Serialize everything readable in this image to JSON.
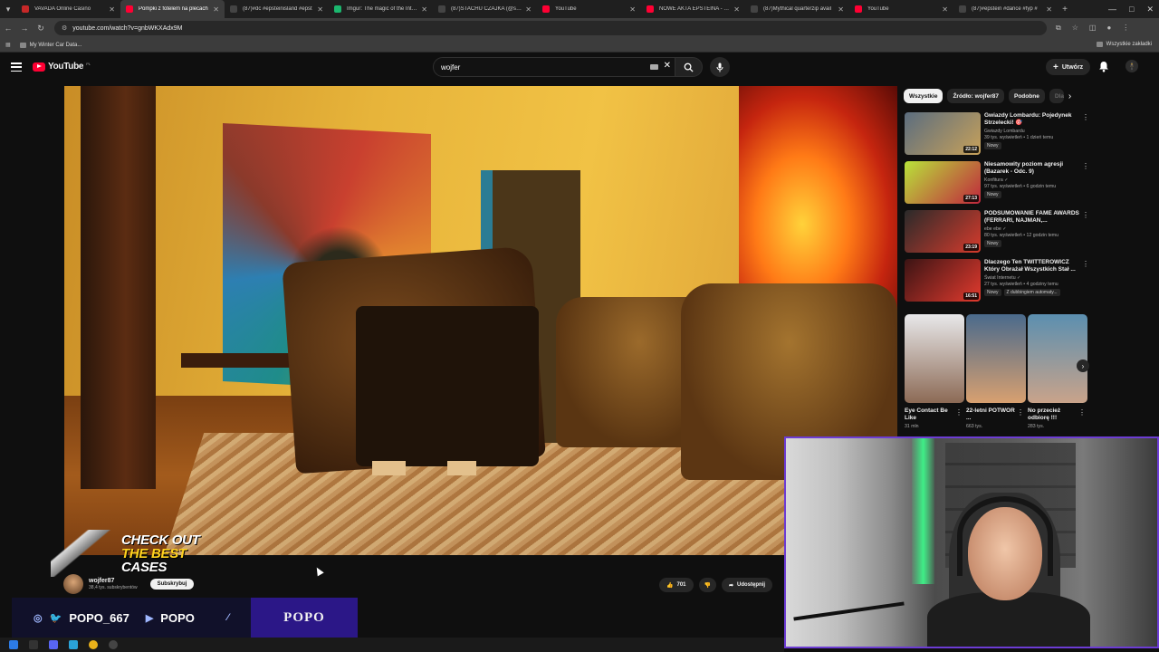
{
  "browser": {
    "tabs": [
      {
        "label": "VAVADA Online Casino",
        "color": "#c62828",
        "active": false
      },
      {
        "label": "Pompki z fotelem na plecach",
        "color": "#ff0033",
        "active": true
      },
      {
        "label": "(87)#dc #epsteinisland #epst",
        "color": "#444",
        "active": false
      },
      {
        "label": "Imgur: The magic of the Intern",
        "color": "#1bb76e",
        "active": false
      },
      {
        "label": "(87)STACHU CZAJKA (@stach",
        "color": "#444",
        "active": false
      },
      {
        "label": "YouTube",
        "color": "#ff0033",
        "active": false
      },
      {
        "label": "NOWE AKTA EPSTEINA - TRU",
        "color": "#ff0033",
        "active": false
      },
      {
        "label": "(87)Mythical quarterzip avail",
        "color": "#444",
        "active": false
      },
      {
        "label": "YouTube",
        "color": "#ff0033",
        "active": false
      },
      {
        "label": "(87)#epstein #dance #fyp #",
        "color": "#444",
        "active": false
      }
    ],
    "url": "youtube.com/watch?v=gnbWKXAdx9M",
    "bookmark": "My Winter Car Data...",
    "bookmarks_all": "Wszystkie zakładki"
  },
  "youtube": {
    "logo": "YouTube",
    "logo_country": "PL",
    "search_value": "wojfer",
    "create_label": "Utwórz"
  },
  "video": {
    "channel_name": "wojfer87",
    "subscribers": "38,4 tys. subskrybentów",
    "subscribe_label": "Subskrybuj",
    "likes": "701",
    "share_label": "Udostępnij"
  },
  "sidebar": {
    "chips": [
      "Wszystkie",
      "Źródło: wojfer87",
      "Podobne",
      "Dla"
    ],
    "recommendations": [
      {
        "title": "Gwiazdy Lombardu: Pojedynek Strzelecki! 🎯",
        "channel": "Gwiazdy Lombardu",
        "views": "39 tys. wyświetleń • 1 dzień temu",
        "duration": "22:12",
        "badges": [
          "Nowy"
        ],
        "thumb_colors": [
          "#5b6d7f",
          "#c7a15a"
        ]
      },
      {
        "title": "Niesamowity poziom agresji (Bazarek - Odc. 9)",
        "channel": "Konfitura ✓",
        "views": "97 tys. wyświetleń • 6 godzin temu",
        "duration": "27:13",
        "badges": [
          "Nowy"
        ],
        "thumb_colors": [
          "#b9e33a",
          "#c0263d"
        ]
      },
      {
        "title": "PODSUMOWANIE FAME AWARDS (FERRARI, NAJMAN,...",
        "channel": "ebe ebe ✓",
        "views": "80 tys. wyświetleń • 12 godzin temu",
        "duration": "23:19",
        "badges": [
          "Nowy"
        ],
        "thumb_colors": [
          "#2a2a2a",
          "#d63b2c"
        ]
      },
      {
        "title": "Dlaczego Ten TWITTEROWICZ Który Obrażał Wszystkich Stał ...",
        "channel": "Świat Internetu ✓",
        "views": "27 tys. wyświetleń • 4 godziny temu",
        "duration": "16:51",
        "badges": [
          "Nowy",
          "Z dubbingiem automaty..."
        ],
        "thumb_colors": [
          "#3b1414",
          "#e23a2e"
        ]
      }
    ],
    "shorts": [
      {
        "title": "Eye Contact Be Like",
        "views": "31 mln",
        "thumb_colors": [
          "#e8e8ea",
          "#8c6a55"
        ]
      },
      {
        "title": "22-letni POTWÓR ...",
        "views": "663 tys.",
        "thumb_colors": [
          "#4a6a8c",
          "#d8a070"
        ]
      },
      {
        "title": "No przecież odbiorę !!!",
        "views": "283 tys.",
        "thumb_colors": [
          "#5b8fb0",
          "#c9a38a"
        ]
      }
    ]
  },
  "overlay": {
    "promo_line1": "CHECK OUT",
    "promo_line2": "THE BEST",
    "promo_line3": "CASES",
    "social_handle": "POPO_667",
    "youtube_handle": "POPO",
    "brand": "POPO"
  }
}
